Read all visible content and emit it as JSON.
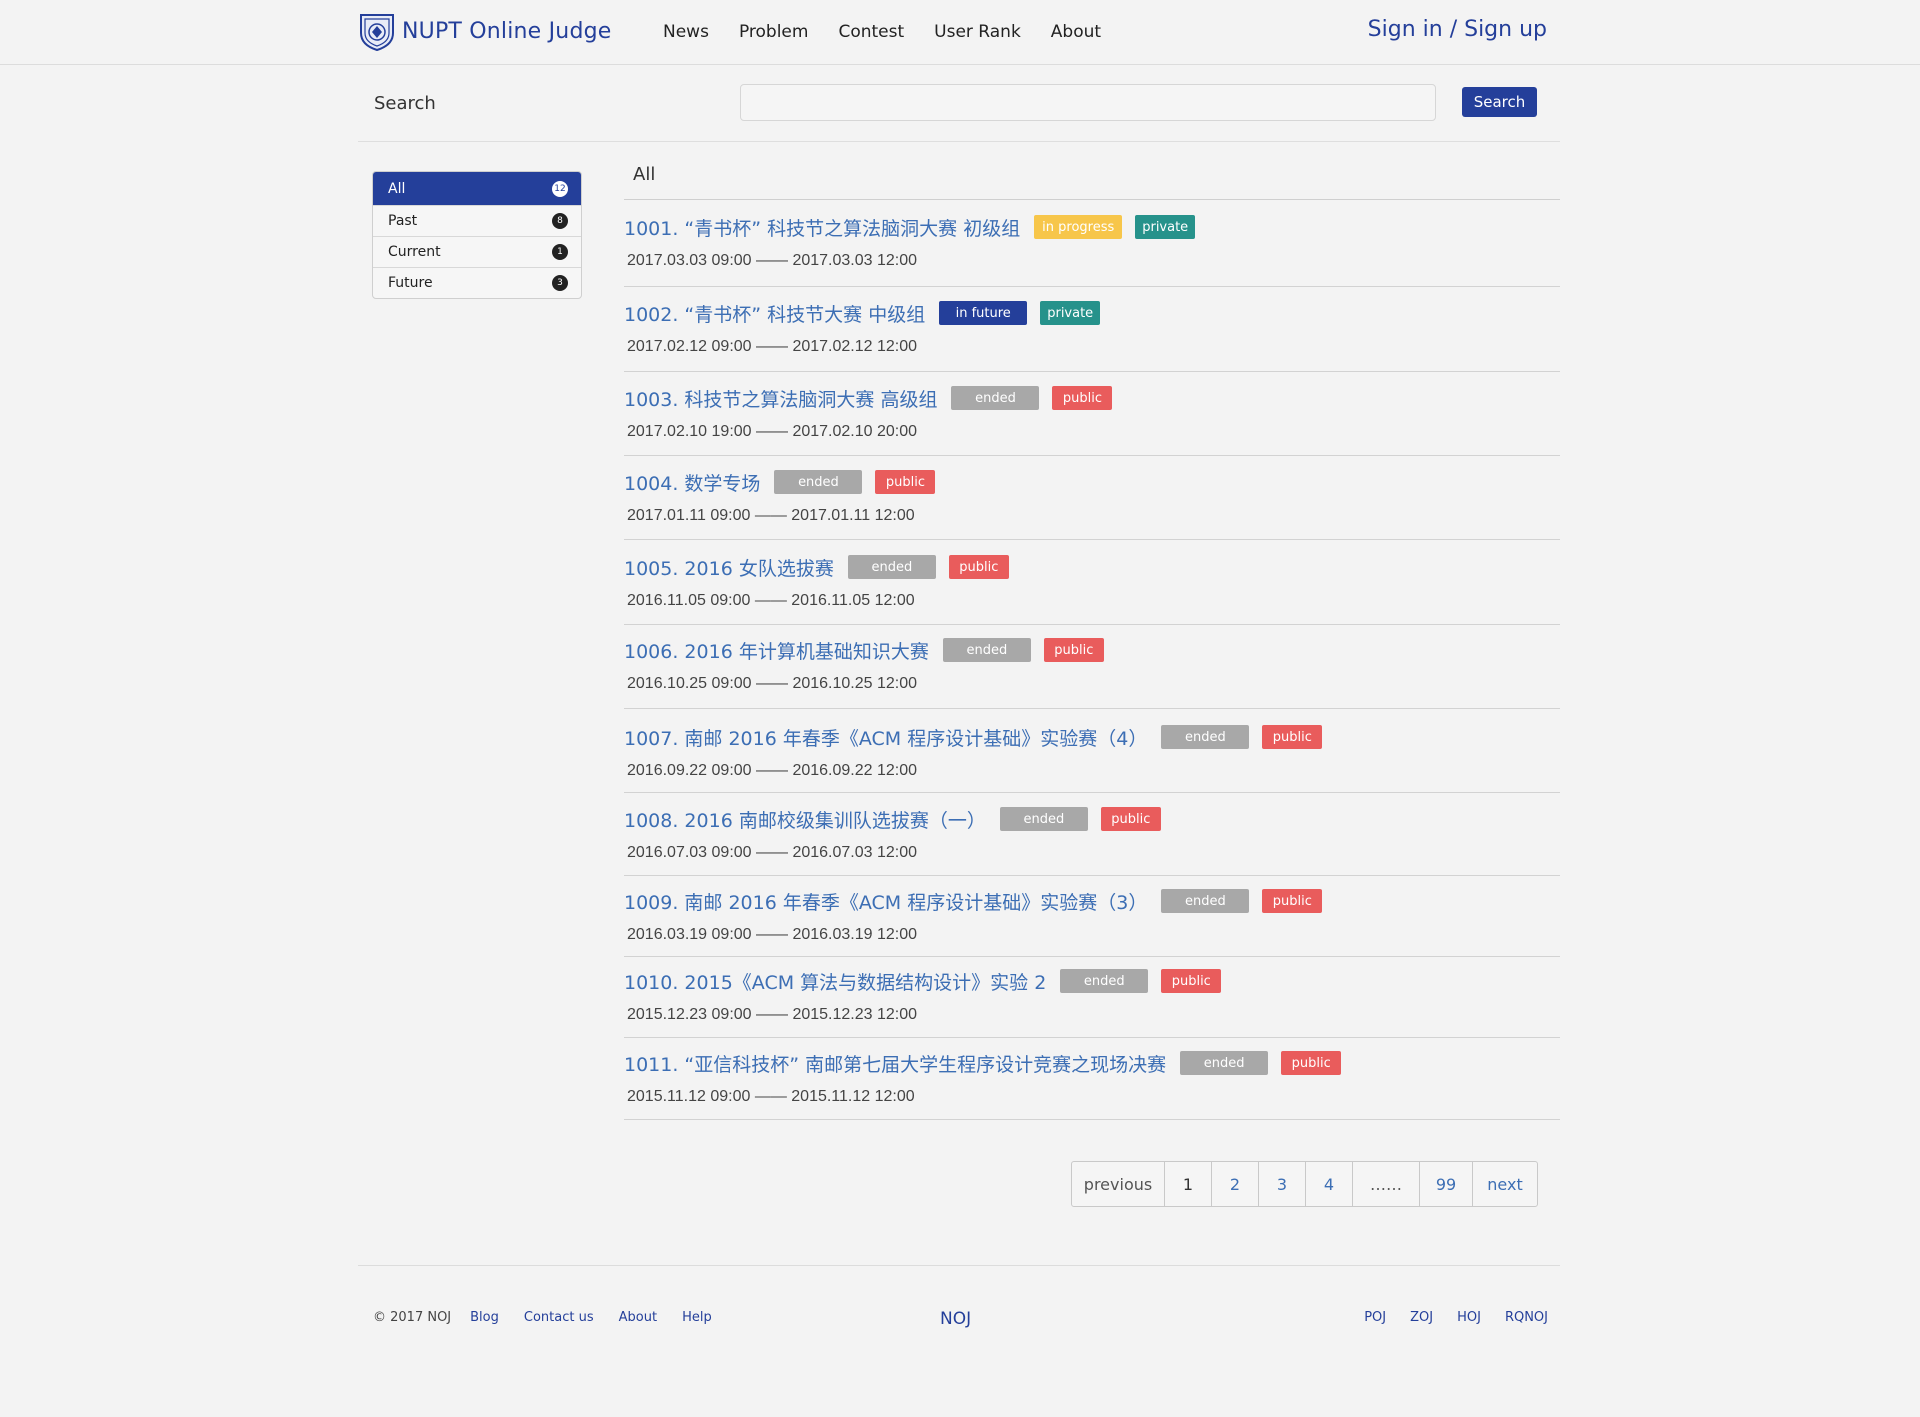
{
  "header": {
    "brand": "NUPT Online Judge",
    "nav": [
      "News",
      "Problem",
      "Contest",
      "User Rank",
      "About"
    ],
    "sign": "Sign in / Sign up"
  },
  "search": {
    "label": "Search",
    "value": "",
    "placeholder": "",
    "button": "Search"
  },
  "filters": [
    {
      "label": "All",
      "count": "12",
      "active": true
    },
    {
      "label": "Past",
      "count": "8",
      "active": false
    },
    {
      "label": "Current",
      "count": "1",
      "active": false
    },
    {
      "label": "Future",
      "count": "3",
      "active": false
    }
  ],
  "list_heading": "All",
  "contests": [
    {
      "title": "1001. “青书杯” 科技节之算法脑洞大赛 初级组",
      "status": "in progress",
      "status_type": "progress",
      "visibility": "private",
      "time": "2017.03.03  09:00 —— 2017.03.03 12:00"
    },
    {
      "title": "1002. “青书杯” 科技节大赛 中级组",
      "status": "in future",
      "status_type": "future",
      "visibility": "private",
      "time": "2017.02.12  09:00 —— 2017.02.12 12:00"
    },
    {
      "title": "1003. 科技节之算法脑洞大赛 高级组",
      "status": "ended",
      "status_type": "ended",
      "visibility": "public",
      "time": "2017.02.10  19:00 —— 2017.02.10 20:00"
    },
    {
      "title": "1004. 数学专场",
      "status": "ended",
      "status_type": "ended",
      "visibility": "public",
      "time": "2017.01.11  09:00 —— 2017.01.11 12:00"
    },
    {
      "title": "1005. 2016 女队选拔赛",
      "status": "ended",
      "status_type": "ended",
      "visibility": "public",
      "time": "2016.11.05  09:00 —— 2016.11.05 12:00"
    },
    {
      "title": "1006. 2016 年计算机基础知识大赛",
      "status": "ended",
      "status_type": "ended",
      "visibility": "public",
      "time": "2016.10.25  09:00 —— 2016.10.25 12:00"
    },
    {
      "title": "1007. 南邮 2016 年春季《ACM 程序设计基础》实验赛（4）",
      "status": "ended",
      "status_type": "ended",
      "visibility": "public",
      "time": "2016.09.22  09:00 —— 2016.09.22 12:00"
    },
    {
      "title": "1008. 2016 南邮校级集训队选拔赛（一）",
      "status": "ended",
      "status_type": "ended",
      "visibility": "public",
      "time": "2016.07.03  09:00 —— 2016.07.03 12:00"
    },
    {
      "title": "1009. 南邮 2016 年春季《ACM 程序设计基础》实验赛（3）",
      "status": "ended",
      "status_type": "ended",
      "visibility": "public",
      "time": "2016.03.19  09:00 —— 2016.03.19 12:00"
    },
    {
      "title": "1010. 2015《ACM 算法与数据结构设计》实验 2",
      "status": "ended",
      "status_type": "ended",
      "visibility": "public",
      "time": "2015.12.23  09:00 —— 2015.12.23 12:00"
    },
    {
      "title": "1011. “亚信科技杯” 南邮第七届大学生程序设计竞赛之现场决赛",
      "status": "ended",
      "status_type": "ended",
      "visibility": "public",
      "time": "2015.11.12  09:00 —— 2015.11.12 12:00"
    }
  ],
  "pagination": {
    "previous": "previous",
    "pages": [
      "1",
      "2",
      "3",
      "4"
    ],
    "current": "1",
    "ellipsis": "……",
    "last": "99",
    "next": "next"
  },
  "footer": {
    "copyright": "© 2017 NOJ",
    "links": [
      "Blog",
      "Contact us",
      "About",
      "Help"
    ],
    "center": "NOJ",
    "right_links": [
      "POJ",
      "ZOJ",
      "HOJ",
      "RQNOJ"
    ]
  },
  "colors": {
    "brand_blue": "#243f9a",
    "link_blue": "#3c6eb4",
    "in_progress": "#f7c64a",
    "ended": "#a8a8a8",
    "private": "#26928b",
    "public": "#e95c5c"
  }
}
